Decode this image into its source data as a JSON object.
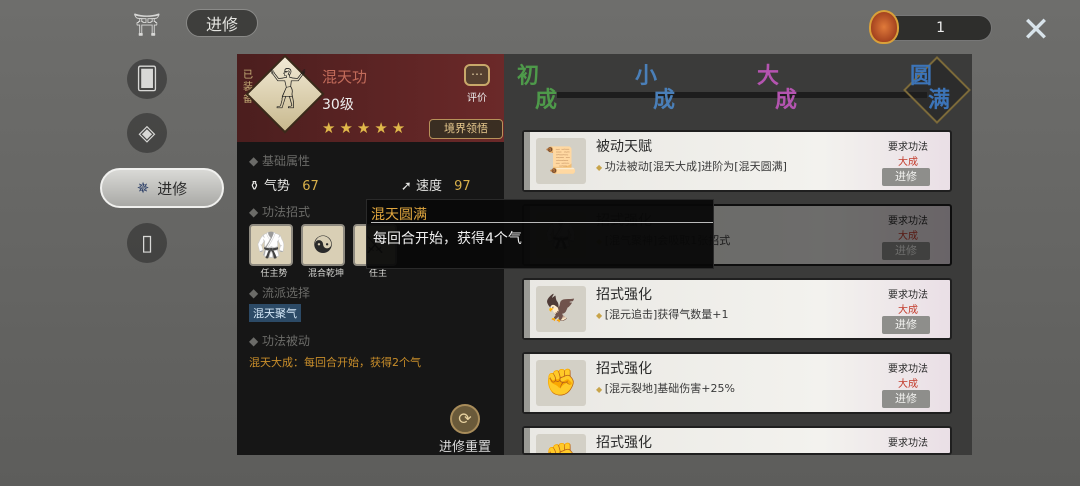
{
  "header": {
    "title": "进修",
    "currency_value": "1",
    "close_icon": "close-x-icon"
  },
  "nav": {
    "items": [
      {
        "icon": "temple-icon"
      },
      {
        "icon": "cards-icon"
      },
      {
        "icon": "card-shield-icon"
      },
      {
        "icon": "progress-icon",
        "label": "进修",
        "active": true
      },
      {
        "icon": "phone-card-icon"
      }
    ]
  },
  "skill": {
    "equipped": "已装备",
    "name": "混天功",
    "level": "30级",
    "stars": "★★★★★",
    "realm_button": "境界领悟",
    "evaluate": "评价",
    "section_base": "基础属性",
    "stat1_label": "气势",
    "stat1_value": "67",
    "stat2_label": "速度",
    "stat2_value": "97",
    "section_moves": "功法招式",
    "moves": [
      "任主势",
      "混合乾坤",
      "任主"
    ],
    "section_flow": "流派选择",
    "flow_tag": "混天聚气",
    "section_passive": "功法被动",
    "passive_text": "混天大成：每回合开始，获得2个气",
    "reset": "进修重置"
  },
  "tooltip": {
    "title": "混天圆满",
    "desc": "每回合开始，获得4个气"
  },
  "stages": [
    {
      "label": "初成",
      "color": "#4e9a4a"
    },
    {
      "label": "小成",
      "color": "#4a7fb8"
    },
    {
      "label": "大成",
      "color": "#b454b0"
    },
    {
      "label": "圆满",
      "color": "#3c74b8"
    }
  ],
  "cards": [
    {
      "title": "被动天赋",
      "desc": "功法被动[混天大成]进阶为[混天圆满]",
      "req1": "要求功法",
      "req2": "大成",
      "button": "进修",
      "icon": "scroll-icon"
    },
    {
      "title": "招式强化",
      "desc": "[混气聚神]会吸取1张招式",
      "req1": "要求功法",
      "req2": "大成",
      "button": "进修",
      "icon": "fighter-icon"
    },
    {
      "title": "招式强化",
      "desc": "[混元追击]获得气数量+1",
      "req1": "要求功法",
      "req2": "大成",
      "button": "进修",
      "icon": "wings-icon"
    },
    {
      "title": "招式强化",
      "desc": "[混元裂地]基础伤害+25%",
      "req1": "要求功法",
      "req2": "大成",
      "button": "进修",
      "icon": "strike-icon"
    },
    {
      "title": "招式强化",
      "desc": "",
      "req1": "要求功法",
      "req2": "",
      "button": "",
      "icon": "fist-icon"
    }
  ]
}
